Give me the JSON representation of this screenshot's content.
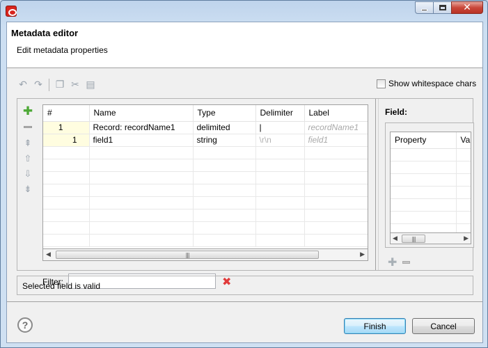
{
  "window": {
    "title": ""
  },
  "header": {
    "title": "Metadata editor",
    "subtitle": "Edit metadata properties"
  },
  "toolbar": {
    "show_whitespace_label": "Show whitespace chars",
    "show_whitespace_checked": false
  },
  "table": {
    "columns": [
      "#",
      "Name",
      "Type",
      "Delimiter",
      "Label"
    ],
    "rows": [
      {
        "num": "1",
        "name": "Record: recordName1",
        "type": "delimited",
        "delimiter": "|",
        "label": "recordName1"
      },
      {
        "num": "1",
        "name": "field1",
        "type": "string",
        "delimiter": "\\r\\n",
        "label": "field1"
      }
    ]
  },
  "filter": {
    "label": "Filter:",
    "value": ""
  },
  "field_panel": {
    "title": "Field:",
    "columns": [
      "Property",
      "Va"
    ]
  },
  "status": {
    "message": "Selected field is valid"
  },
  "buttons": {
    "finish": "Finish",
    "cancel": "Cancel",
    "help": "?"
  },
  "icons": {
    "app": "app-logo-icon",
    "undo": "undo-icon",
    "redo": "redo-icon",
    "copy": "copy-icon",
    "cut": "cut-icon",
    "paste": "paste-icon",
    "add": "add-icon",
    "remove": "remove-icon",
    "move_top": "move-top-icon",
    "move_up": "move-up-icon",
    "move_down": "move-down-icon",
    "move_bottom": "move-bottom-icon",
    "clear_filter": "clear-filter-icon"
  },
  "colors": {
    "accent_add": "#4da836",
    "clear_filter": "#e03a3a",
    "number_cell_bg": "#fffde0",
    "close_button": "#c9473a"
  }
}
